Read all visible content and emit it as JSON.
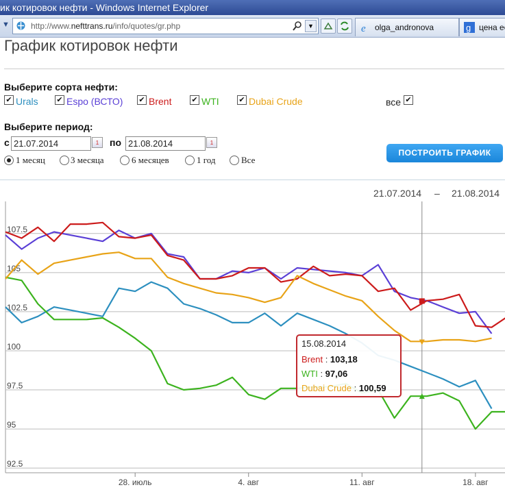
{
  "window": {
    "title": "ик котировок нефти - Windows Internet Explorer",
    "url_prefix": "http://www.",
    "url_host": "nefttrans.ru",
    "url_path": "/info/quotes/gr.php",
    "tabs": [
      {
        "label": "olga_andronova",
        "icon": "ie-icon"
      },
      {
        "label": "цена ее",
        "icon": "google-icon"
      }
    ]
  },
  "page": {
    "title": "График котировок нефти",
    "select_sorts_label": "Выберите сорта нефти:",
    "sorts": [
      {
        "label": "Urals",
        "checked": true,
        "color": "#2c8fbf"
      },
      {
        "label": "Espo (ВСТО)",
        "checked": true,
        "color": "#5a3fd6"
      },
      {
        "label": "Brent",
        "checked": true,
        "color": "#cc1b1b"
      },
      {
        "label": "WTI",
        "checked": true,
        "color": "#3cb31e"
      },
      {
        "label": "Dubai Crude",
        "checked": true,
        "color": "#e8a317"
      }
    ],
    "all_label": "все",
    "all_checked": true,
    "check_mark": "✔",
    "select_period_label": "Выберите период:",
    "from_label": "с",
    "to_label": "по",
    "date_from": "21.07.2014",
    "date_to": "21.08.2014",
    "calendar_glyph": "1",
    "periods": [
      {
        "label": "1 месяц",
        "selected": true
      },
      {
        "label": "3 месяца",
        "selected": false
      },
      {
        "label": "6 месяцев",
        "selected": false
      },
      {
        "label": "1 год",
        "selected": false
      },
      {
        "label": "Все",
        "selected": false
      }
    ],
    "build_button": "ПОСТРОИТЬ ГРАФИК",
    "range_from": "21.07.2014",
    "range_sep": "–",
    "range_to": "21.08.2014"
  },
  "chart_data": {
    "type": "line",
    "x_unit": "day",
    "xticks": [
      {
        "day": 28,
        "label": "28. июль"
      },
      {
        "day": 35,
        "label": "4. авг"
      },
      {
        "day": 42,
        "label": "11. авг"
      },
      {
        "day": 49,
        "label": "18. авг"
      }
    ],
    "yticks": [
      107.5,
      105,
      102.5,
      100,
      97.5,
      95,
      92.5
    ],
    "ytick_labels": [
      "107.5",
      "105",
      "102.5",
      "100",
      "97.5",
      "95",
      "92.5"
    ],
    "ylim": [
      92.2,
      109.2
    ],
    "grid": true,
    "crosshair_day": 45.7,
    "series": [
      {
        "name": "Urals",
        "color": "#2c8fbf",
        "points": [
          [
            20,
            102.8
          ],
          [
            21,
            101.8
          ],
          [
            22,
            102.2
          ],
          [
            23,
            102.8
          ],
          [
            24,
            102.6
          ],
          [
            25,
            102.4
          ],
          [
            26,
            102.2
          ],
          [
            27,
            104
          ],
          [
            28,
            103.8
          ],
          [
            29,
            104.4
          ],
          [
            30,
            104
          ],
          [
            31,
            103
          ],
          [
            32,
            102.7
          ],
          [
            33,
            102.3
          ],
          [
            34,
            101.8
          ],
          [
            35,
            101.8
          ],
          [
            36,
            102.4
          ],
          [
            37,
            101.6
          ],
          [
            38,
            102.4
          ],
          [
            39,
            102
          ],
          [
            40,
            101.6
          ],
          [
            41,
            101.1
          ],
          [
            42,
            100.5
          ],
          [
            43,
            99.7
          ],
          [
            44,
            99.4
          ],
          [
            45,
            99
          ],
          [
            46,
            98.6
          ],
          [
            47,
            98.2
          ],
          [
            48,
            97.7
          ],
          [
            49,
            98.1
          ],
          [
            50,
            96.3
          ]
        ]
      },
      {
        "name": "Espo (ВСТО)",
        "color": "#5a3fd6",
        "points": [
          [
            20,
            107.4
          ],
          [
            21,
            106.5
          ],
          [
            22,
            107.2
          ],
          [
            23,
            107.6
          ],
          [
            24,
            107.4
          ],
          [
            25,
            107.2
          ],
          [
            26,
            107
          ],
          [
            27,
            107.7
          ],
          [
            28,
            107.2
          ],
          [
            29,
            107.5
          ],
          [
            30,
            106.2
          ],
          [
            31,
            106
          ],
          [
            32,
            104.6
          ],
          [
            33,
            104.6
          ],
          [
            34,
            105.1
          ],
          [
            35,
            105
          ],
          [
            36,
            105.3
          ],
          [
            37,
            104.6
          ],
          [
            38,
            105.3
          ],
          [
            39,
            105.2
          ],
          [
            40,
            105.1
          ],
          [
            41,
            105
          ],
          [
            42,
            104.8
          ],
          [
            43,
            105.5
          ],
          [
            44,
            103.8
          ],
          [
            45,
            103.4
          ],
          [
            46,
            103.2
          ],
          [
            47,
            102.8
          ],
          [
            48,
            102.4
          ],
          [
            49,
            102.5
          ],
          [
            50,
            101.1
          ]
        ]
      },
      {
        "name": "Brent",
        "color": "#cc1b1b",
        "points": [
          [
            20,
            107.6
          ],
          [
            21,
            107.2
          ],
          [
            22,
            107.9
          ],
          [
            23,
            107
          ],
          [
            24,
            108.1
          ],
          [
            25,
            108.1
          ],
          [
            26,
            108.2
          ],
          [
            27,
            107.3
          ],
          [
            28,
            107.2
          ],
          [
            29,
            107.4
          ],
          [
            30,
            106.1
          ],
          [
            31,
            105.8
          ],
          [
            32,
            104.6
          ],
          [
            33,
            104.6
          ],
          [
            34,
            104.8
          ],
          [
            35,
            105.3
          ],
          [
            36,
            105.3
          ],
          [
            37,
            104.4
          ],
          [
            38,
            104.6
          ],
          [
            39,
            105.4
          ],
          [
            40,
            104.8
          ],
          [
            41,
            104.9
          ],
          [
            42,
            104.8
          ],
          [
            43,
            103.8
          ],
          [
            44,
            104
          ],
          [
            45,
            102.6
          ],
          [
            46,
            103.2
          ],
          [
            47,
            103.3
          ],
          [
            48,
            103.6
          ],
          [
            49,
            101.6
          ],
          [
            50,
            101.5
          ],
          [
            51,
            102.2
          ],
          [
            52,
            101.9
          ]
        ]
      },
      {
        "name": "WTI",
        "color": "#3cb31e",
        "points": [
          [
            20,
            104.7
          ],
          [
            21,
            104.5
          ],
          [
            22,
            103
          ],
          [
            23,
            102
          ],
          [
            24,
            102
          ],
          [
            25,
            102
          ],
          [
            26,
            102.1
          ],
          [
            27,
            101.5
          ],
          [
            28,
            100.8
          ],
          [
            29,
            100
          ],
          [
            30,
            97.9
          ],
          [
            31,
            97.5
          ],
          [
            32,
            97.6
          ],
          [
            33,
            97.8
          ],
          [
            34,
            98.3
          ],
          [
            35,
            97.2
          ],
          [
            36,
            96.9
          ],
          [
            37,
            97.6
          ],
          [
            38,
            97.6
          ],
          [
            39,
            97.7
          ],
          [
            40,
            97.7
          ],
          [
            41,
            97.9
          ],
          [
            42,
            97.3
          ],
          [
            43,
            97.5
          ],
          [
            44,
            95.7
          ],
          [
            45,
            97.1
          ],
          [
            46,
            97.1
          ],
          [
            47,
            97.3
          ],
          [
            48,
            96.8
          ],
          [
            49,
            95
          ],
          [
            50,
            96.1
          ],
          [
            51,
            96.1
          ]
        ]
      },
      {
        "name": "Dubai Crude",
        "color": "#e8a317",
        "points": [
          [
            20,
            104.6
          ],
          [
            21,
            105.8
          ],
          [
            22,
            104.9
          ],
          [
            23,
            105.6
          ],
          [
            24,
            105.8
          ],
          [
            25,
            106
          ],
          [
            26,
            106.2
          ],
          [
            27,
            106.3
          ],
          [
            28,
            105.9
          ],
          [
            29,
            105.9
          ],
          [
            30,
            104.7
          ],
          [
            31,
            104.3
          ],
          [
            32,
            104
          ],
          [
            33,
            103.7
          ],
          [
            34,
            103.6
          ],
          [
            35,
            103.4
          ],
          [
            36,
            103.1
          ],
          [
            37,
            103.4
          ],
          [
            38,
            104.8
          ],
          [
            39,
            104.3
          ],
          [
            40,
            103.9
          ],
          [
            41,
            103.5
          ],
          [
            42,
            103.2
          ],
          [
            43,
            102.2
          ],
          [
            44,
            101.3
          ],
          [
            45,
            100.6
          ],
          [
            46,
            100.6
          ],
          [
            47,
            100.7
          ],
          [
            48,
            100.7
          ],
          [
            49,
            100.6
          ],
          [
            50,
            100.8
          ]
        ]
      }
    ],
    "tooltip": {
      "date": "15.08.2014",
      "rows": [
        {
          "name": "Brent",
          "value": "103,18",
          "color": "#cc1b1b"
        },
        {
          "name": "WTI",
          "value": "97,06",
          "color": "#3cb31e"
        },
        {
          "name": "Dubai Crude",
          "value": "100,59",
          "color": "#e8a317"
        }
      ]
    },
    "markers": [
      {
        "series": "Brent",
        "day": 45.7,
        "value": 103.18,
        "shape": "square"
      },
      {
        "series": "WTI",
        "day": 45.7,
        "value": 97.06,
        "shape": "triangle-up"
      },
      {
        "series": "Dubai Crude",
        "day": 45.7,
        "value": 100.59,
        "shape": "triangle-down"
      }
    ]
  }
}
